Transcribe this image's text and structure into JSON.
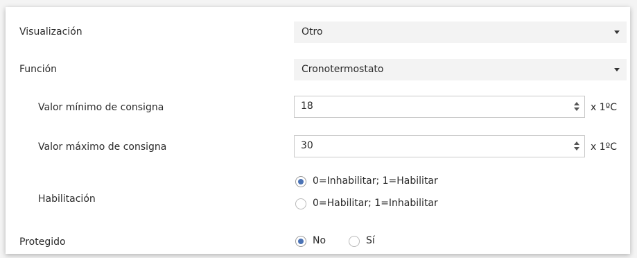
{
  "fields": {
    "visualizacion": {
      "label": "Visualización",
      "value": "Otro"
    },
    "funcion": {
      "label": "Función",
      "value": "Cronotermostato"
    },
    "valor_minimo": {
      "label": "Valor mínimo de consigna",
      "value": "18",
      "unit": "x 1ºC"
    },
    "valor_maximo": {
      "label": "Valor máximo de consigna",
      "value": "30",
      "unit": "x 1ºC"
    },
    "habilitacion": {
      "label": "Habilitación",
      "options": [
        "0=Inhabilitar; 1=Habilitar",
        "0=Habilitar; 1=Inhabilitar"
      ],
      "selected": "0=Inhabilitar; 1=Habilitar"
    },
    "protegido": {
      "label": "Protegido",
      "options": [
        "No",
        "Sí"
      ],
      "selected": "No"
    }
  },
  "colors": {
    "accent": "#4b73b5",
    "dropdown_bg": "#f3f3f3",
    "text": "#2a2a2a"
  },
  "icons": [
    "dropdown-caret-icon",
    "spinner-up-icon",
    "spinner-down-icon"
  ]
}
